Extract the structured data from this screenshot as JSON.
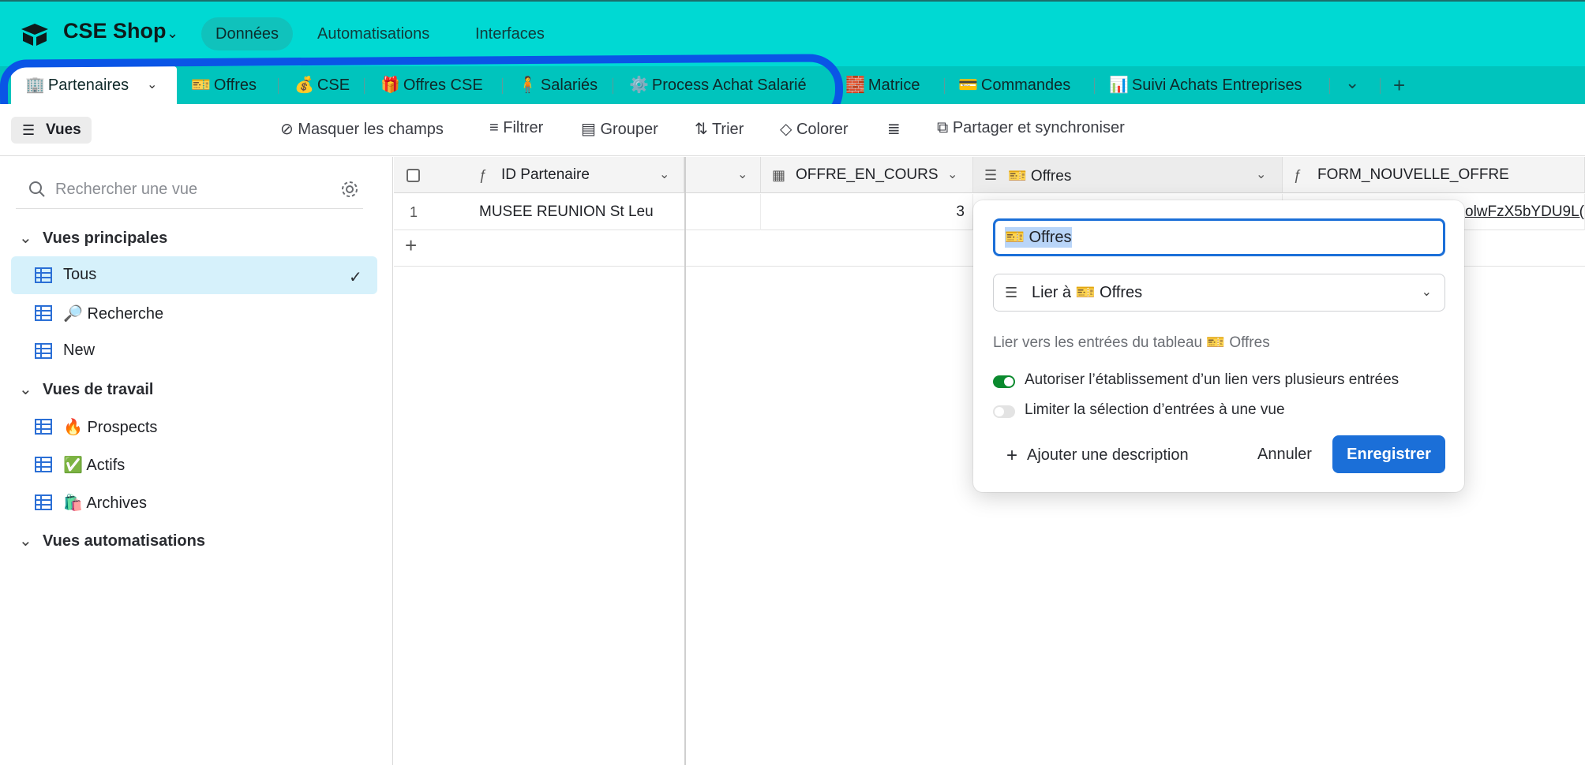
{
  "app": {
    "base_name": "CSE Shop",
    "nav": [
      "Données",
      "Automatisations",
      "Interfaces"
    ]
  },
  "tabs": [
    {
      "emoji": "🏢",
      "label": "Partenaires"
    },
    {
      "emoji": "🎫",
      "label": "Offres"
    },
    {
      "emoji": "💰",
      "label": "CSE"
    },
    {
      "emoji": "🎁",
      "label": "Offres CSE"
    },
    {
      "emoji": "🧍",
      "label": "Salariés"
    },
    {
      "emoji": "⚙️",
      "label": "Process Achat Salarié"
    },
    {
      "emoji": "🧱",
      "label": "Matrice"
    },
    {
      "emoji": "💳",
      "label": "Commandes"
    },
    {
      "emoji": "📊",
      "label": "Suivi Achats Entreprises"
    }
  ],
  "toolbar": {
    "views": "Vues",
    "hide_fields": "Masquer les champs",
    "filter": "Filtrer",
    "group": "Grouper",
    "sort": "Trier",
    "color": "Colorer",
    "share": "Partager et synchroniser"
  },
  "sidebar": {
    "search_placeholder": "Rechercher une vue",
    "sections": [
      {
        "title": "Vues principales",
        "items": [
          {
            "label": "Tous",
            "active": true
          },
          {
            "label": "🔎 Recherche"
          },
          {
            "label": "New"
          }
        ]
      },
      {
        "title": "Vues de travail",
        "items": [
          {
            "label": "🔥 Prospects"
          },
          {
            "label": "✅ Actifs"
          },
          {
            "label": "🛍️ Archives"
          }
        ]
      },
      {
        "title": "Vues automatisations",
        "items": []
      }
    ]
  },
  "grid": {
    "columns": [
      {
        "label": "ID Partenaire",
        "type": "formula"
      },
      {
        "label": "",
        "type": "hidden"
      },
      {
        "label": "OFFRE_EN_COURS",
        "type": "count"
      },
      {
        "label": "🎫 Offres",
        "type": "link"
      },
      {
        "label": "FORM_NOUVELLE_OFFRE",
        "type": "formula"
      }
    ],
    "rows": [
      {
        "num": "1",
        "id_partenaire": "MUSEE REUNION St Leu",
        "offre_en_cours": "3",
        "form_nouvelle_offre": "olwFzX5bYDU9L("
      }
    ]
  },
  "popover": {
    "field_name": "🎫 Offres",
    "field_type": "Lier à 🎫 Offres",
    "help": "Lier vers les entrées du tableau 🎫 Offres",
    "toggle_multi": {
      "label": "Autoriser l’établissement d’un lien vers plusieurs entrées",
      "on": true
    },
    "toggle_limit": {
      "label": "Limiter la sélection d’entrées à une vue",
      "on": false
    },
    "add_description": "Ajouter une description",
    "cancel": "Annuler",
    "save": "Enregistrer"
  },
  "colors": {
    "topbar": "#00d9d3",
    "tabbar": "#00c4bd",
    "primary_button": "#1b6fd8",
    "toggle_on": "#0b8a2e",
    "annotation_stroke": "#0a55e6"
  }
}
